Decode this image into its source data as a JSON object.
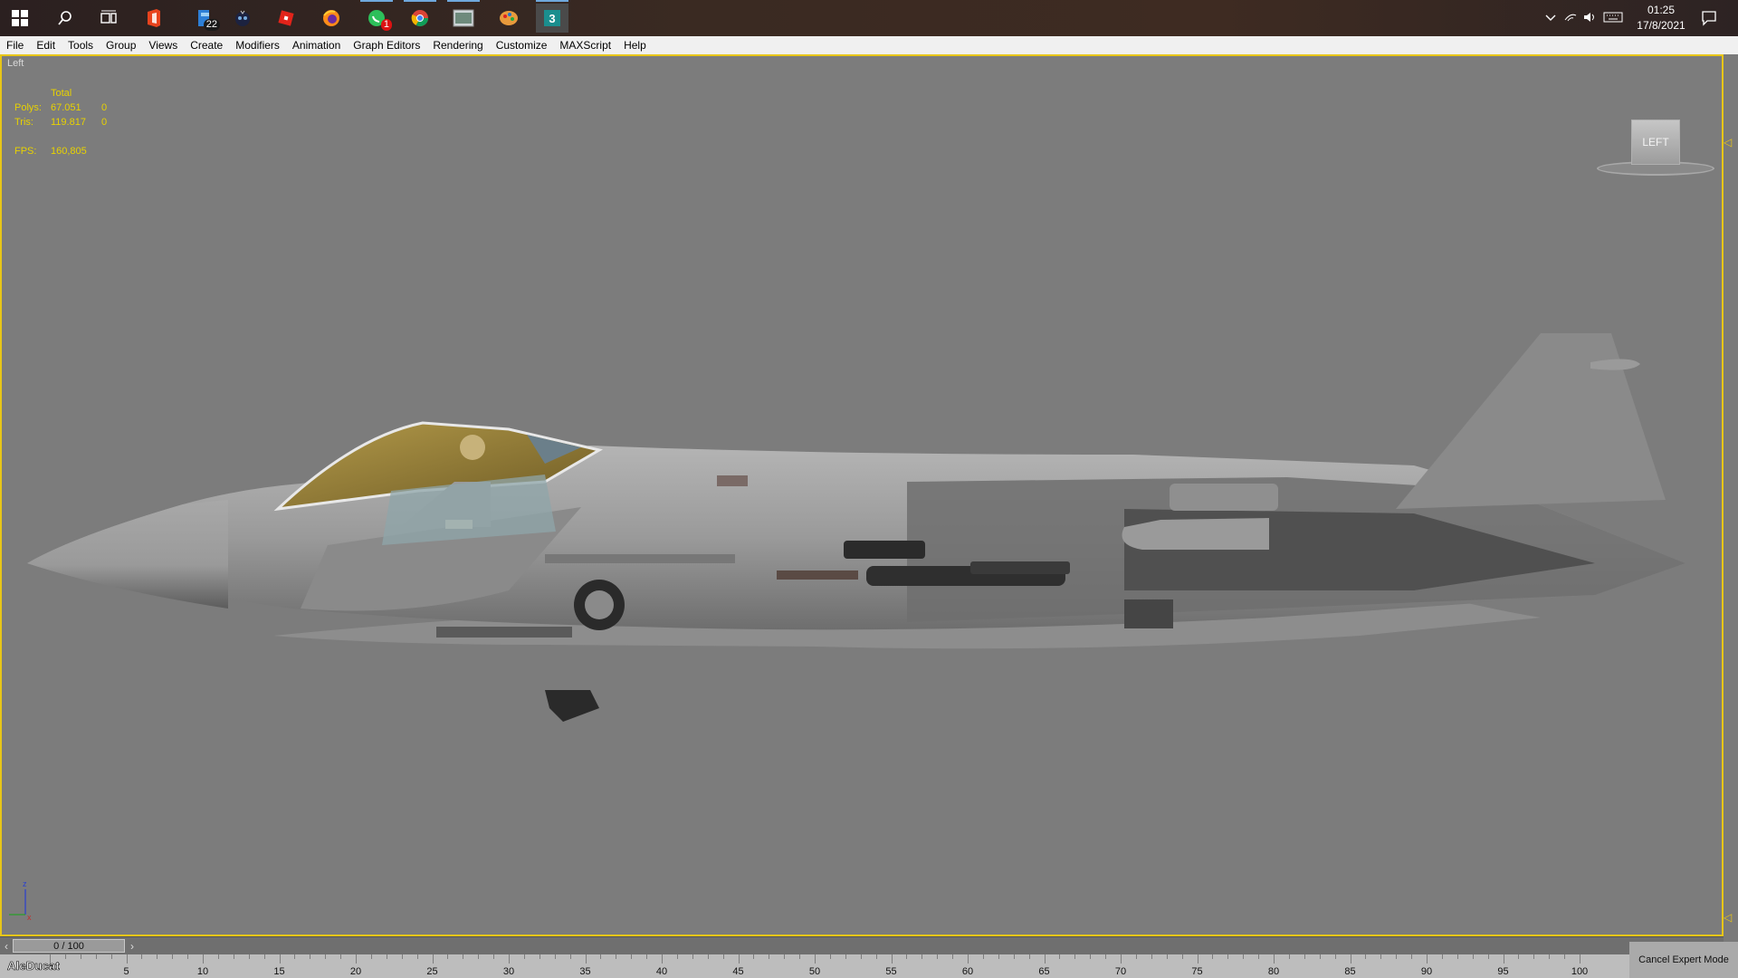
{
  "taskbar": {
    "icons": [
      {
        "name": "windows-start-icon"
      },
      {
        "name": "search-icon"
      },
      {
        "name": "task-view-icon"
      },
      {
        "name": "office-icon"
      },
      {
        "name": "file-explorer-icon",
        "badge": "22"
      },
      {
        "name": "app-mascot-icon"
      },
      {
        "name": "roblox-icon"
      },
      {
        "name": "firefox-icon"
      },
      {
        "name": "whatsapp-icon",
        "badge": "1"
      },
      {
        "name": "chrome-icon"
      },
      {
        "name": "image-viewer-icon"
      },
      {
        "name": "paint-app-icon"
      },
      {
        "name": "3dsmax-icon"
      }
    ],
    "clock": {
      "time": "01:25",
      "date": "17/8/2021"
    }
  },
  "menu": [
    "File",
    "Edit",
    "Tools",
    "Group",
    "Views",
    "Create",
    "Modifiers",
    "Animation",
    "Graph Editors",
    "Rendering",
    "Customize",
    "MAXScript",
    "Help"
  ],
  "viewport": {
    "label": "Left",
    "stats": {
      "header": "Total",
      "polys_label": "Polys:",
      "polys_total": "67.051",
      "polys_selected": "0",
      "tris_label": "Tris:",
      "tris_total": "119.817",
      "tris_selected": "0",
      "fps_label": "FPS:",
      "fps_value": "160,805"
    },
    "viewcube_label": "LEFT",
    "axis_labels": {
      "z": "z",
      "x": "x"
    }
  },
  "timeline": {
    "frame_display": "0 / 100",
    "ticks": [
      "5",
      "10",
      "15",
      "20",
      "25",
      "30",
      "35",
      "40",
      "45",
      "50",
      "55",
      "60",
      "65",
      "70",
      "75",
      "80",
      "85",
      "90",
      "95",
      "100"
    ]
  },
  "status": {
    "cancel_expert_mode": "Cancel Expert Mode"
  },
  "watermark": "AleDucat",
  "colors": {
    "accent": "#e8c618",
    "stats_text": "#e8d200",
    "viewport_bg": "#7c7c7c"
  }
}
